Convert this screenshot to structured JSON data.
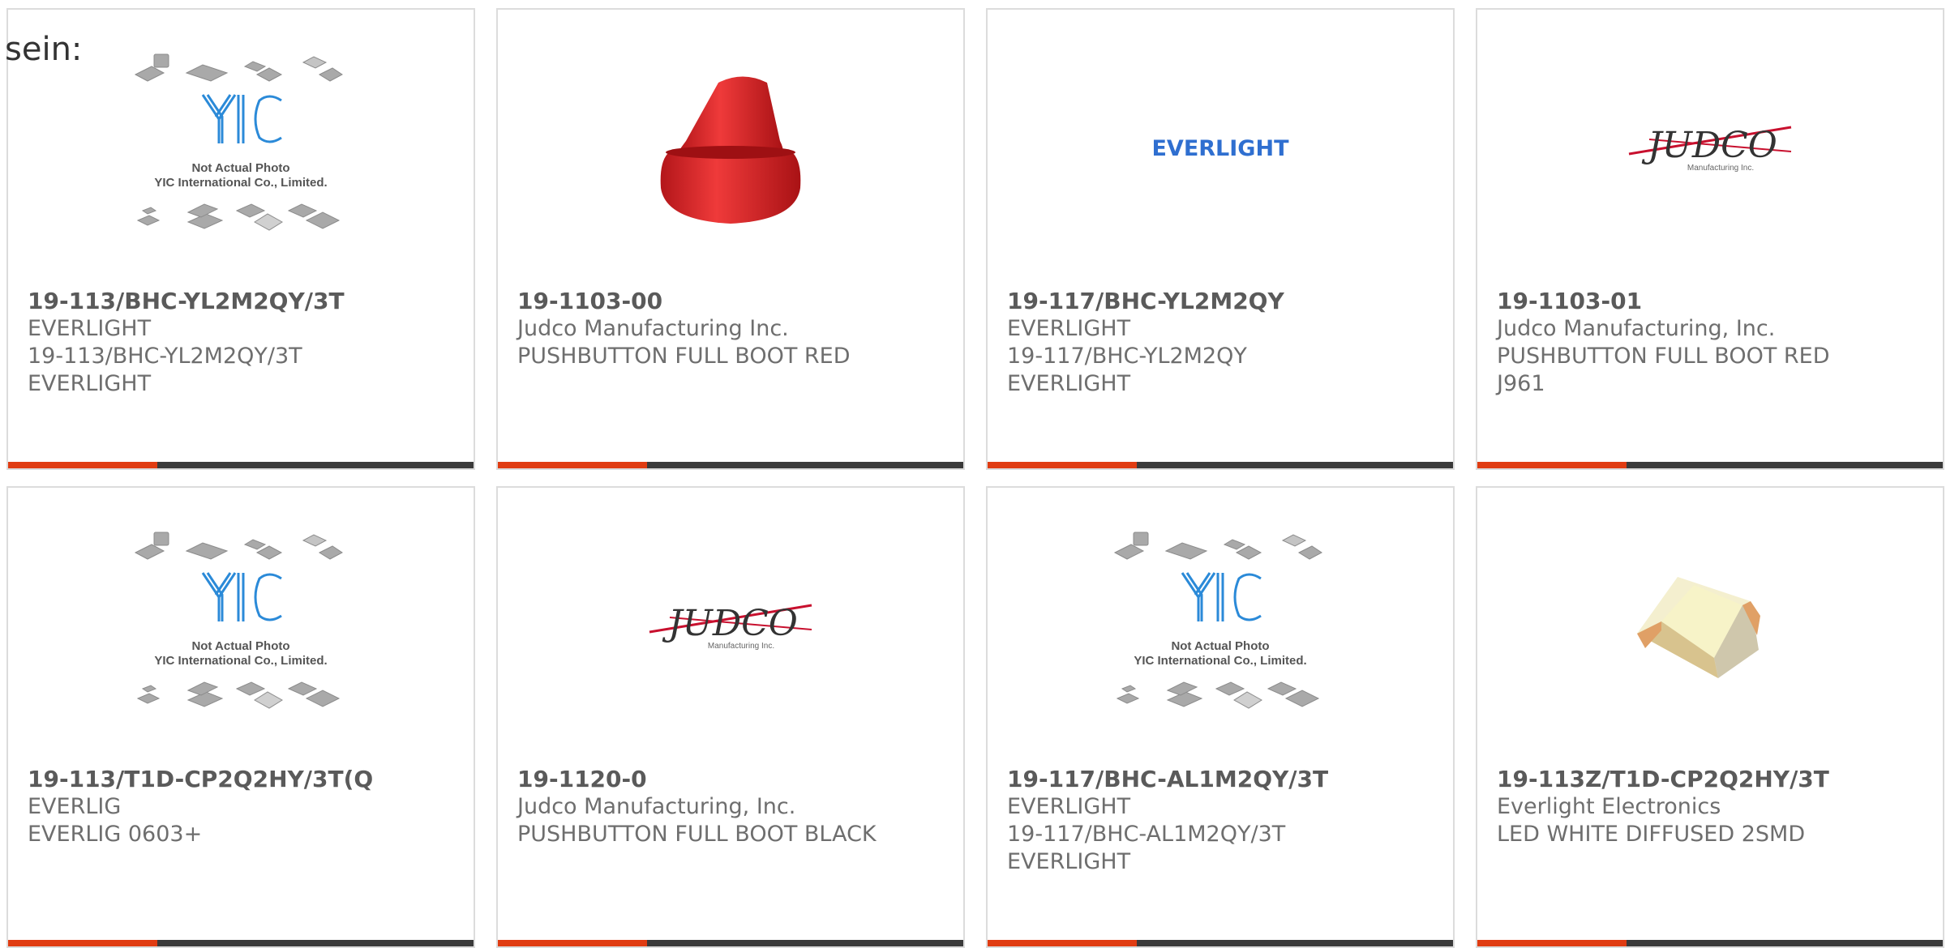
{
  "intro": "sein:",
  "cards": [
    {
      "part": "19-113/BHC-YL2M2QY/3T",
      "lines": [
        "EVERLIGHT",
        "19-113/BHC-YL2M2QY/3T",
        "EVERLIGHT"
      ],
      "image": {
        "kind": "yic-placeholder",
        "caption1": "Not Actual Photo",
        "caption2": "YIC International Co., Limited.",
        "logo": "YIC"
      }
    },
    {
      "part": "19-1103-00",
      "lines": [
        "Judco Manufacturing Inc.",
        "PUSHBUTTON FULL BOOT RED"
      ],
      "image": {
        "kind": "red-boot"
      }
    },
    {
      "part": "19-117/BHC-YL2M2QY",
      "lines": [
        "EVERLIGHT",
        "19-117/BHC-YL2M2QY",
        "EVERLIGHT"
      ],
      "image": {
        "kind": "everlight-logo",
        "text": "EVERLIGHT"
      }
    },
    {
      "part": "19-1103-01",
      "lines": [
        "Judco Manufacturing, Inc.",
        "PUSHBUTTON FULL BOOT RED",
        "J961"
      ],
      "image": {
        "kind": "judco-logo",
        "text": "JUDCO",
        "sub": "Manufacturing Inc."
      }
    },
    {
      "part": "19-113/T1D-CP2Q2HY/3T(Q",
      "lines": [
        "EVERLIG",
        "EVERLIG 0603+"
      ],
      "image": {
        "kind": "yic-placeholder",
        "caption1": "Not Actual Photo",
        "caption2": "YIC International Co., Limited.",
        "logo": "YIC"
      }
    },
    {
      "part": "19-1120-0",
      "lines": [
        "Judco Manufacturing, Inc.",
        "PUSHBUTTON FULL BOOT BLACK"
      ],
      "image": {
        "kind": "judco-logo",
        "text": "JUDCO",
        "sub": "Manufacturing Inc."
      }
    },
    {
      "part": "19-117/BHC-AL1M2QY/3T",
      "lines": [
        "EVERLIGHT",
        "19-117/BHC-AL1M2QY/3T",
        "EVERLIGHT"
      ],
      "image": {
        "kind": "yic-placeholder",
        "caption1": "Not Actual Photo",
        "caption2": "YIC International Co., Limited.",
        "logo": "YIC"
      }
    },
    {
      "part": "19-113Z/T1D-CP2Q2HY/3T",
      "lines": [
        "Everlight Electronics",
        "LED WHITE DIFFUSED 2SMD"
      ],
      "image": {
        "kind": "led-chip"
      }
    }
  ],
  "colors": {
    "accent": "#e03c12",
    "bar": "#3a3a3a",
    "border": "#dcdcdc",
    "everlight": "#2f6fd0",
    "judco_red": "#c8102e",
    "boot_red": "#e8282b"
  }
}
